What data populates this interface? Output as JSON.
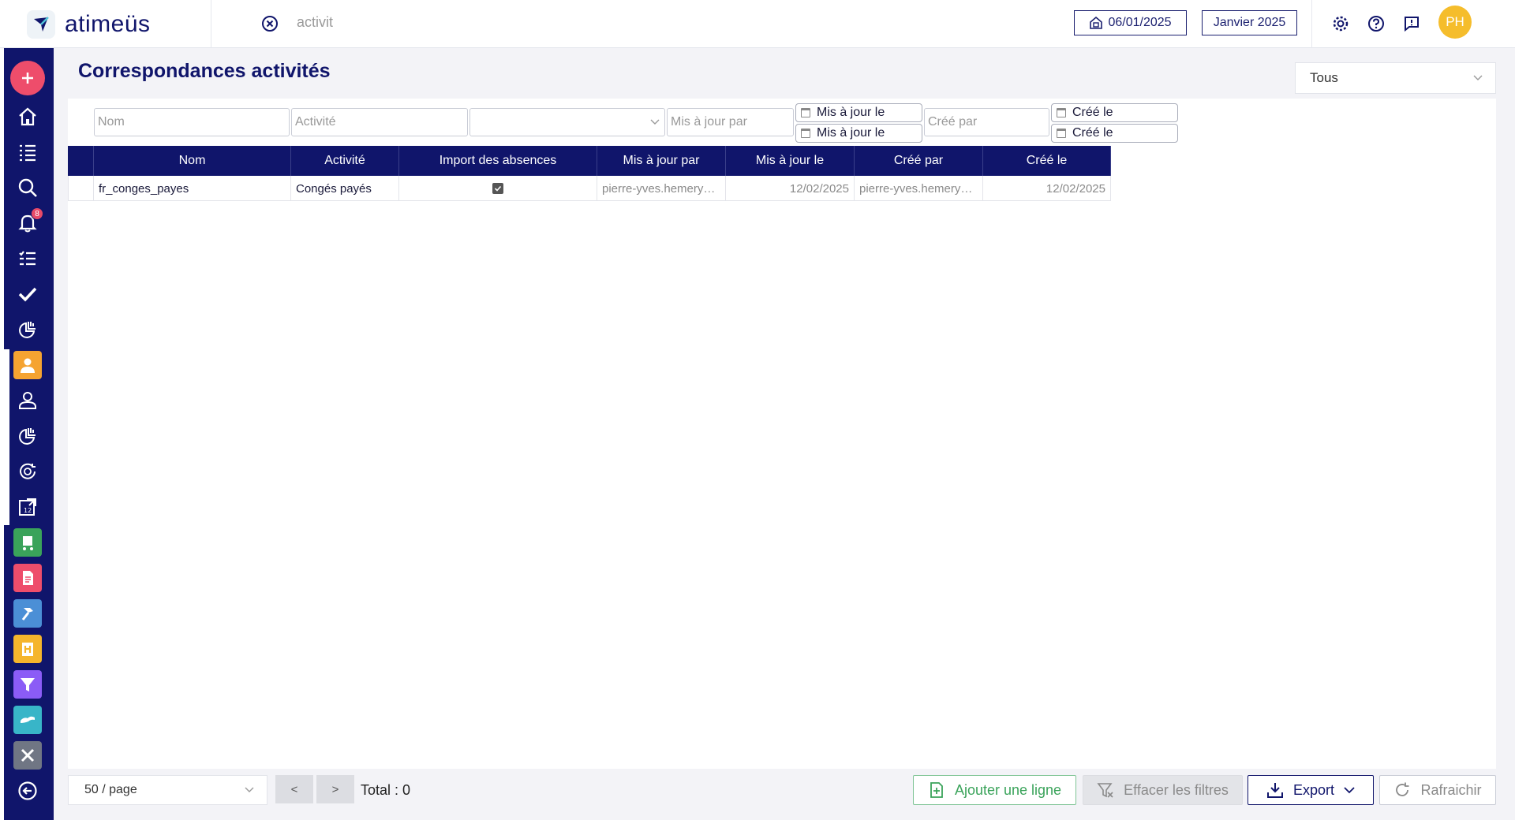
{
  "header": {
    "brand": "atimeüs",
    "search_value": "activit",
    "current_date": "06/01/2025",
    "period": "Janvier 2025",
    "user_initials": "PH",
    "notification_count": "8"
  },
  "page": {
    "title": "Correspondances activités",
    "scope_select": "Tous"
  },
  "filters": {
    "nom_placeholder": "Nom",
    "activite_placeholder": "Activité",
    "maj_par_placeholder": "Mis à jour par",
    "maj_le_from": "Mis à jour le",
    "maj_le_to": "Mis à jour le",
    "cree_par_placeholder": "Créé par",
    "cree_le_from": "Créé le",
    "cree_le_to": "Créé le"
  },
  "table": {
    "columns": [
      "Nom",
      "Activité",
      "Import des absences",
      "Mis à jour par",
      "Mis à jour le",
      "Créé par",
      "Créé le"
    ],
    "rows": [
      {
        "nom": "fr_conges_payes",
        "activite": "Congés payés",
        "import_absences": true,
        "maj_par": "pierre-yves.hemery…",
        "maj_le": "12/02/2025",
        "cree_par": "pierre-yves.hemery…",
        "cree_le": "12/02/2025"
      }
    ]
  },
  "footer": {
    "page_size": "50 / page",
    "prev": "<",
    "next": ">",
    "total": "Total : 0",
    "add_label": "Ajouter une ligne",
    "clear_label": "Effacer les filtres",
    "export_label": "Export",
    "refresh_label": "Rafraichir"
  },
  "colors": {
    "navy": "#10156b",
    "plus": "#ee4d6b",
    "add_green": "#3aa35a",
    "avatar": "#f5bd2c"
  }
}
